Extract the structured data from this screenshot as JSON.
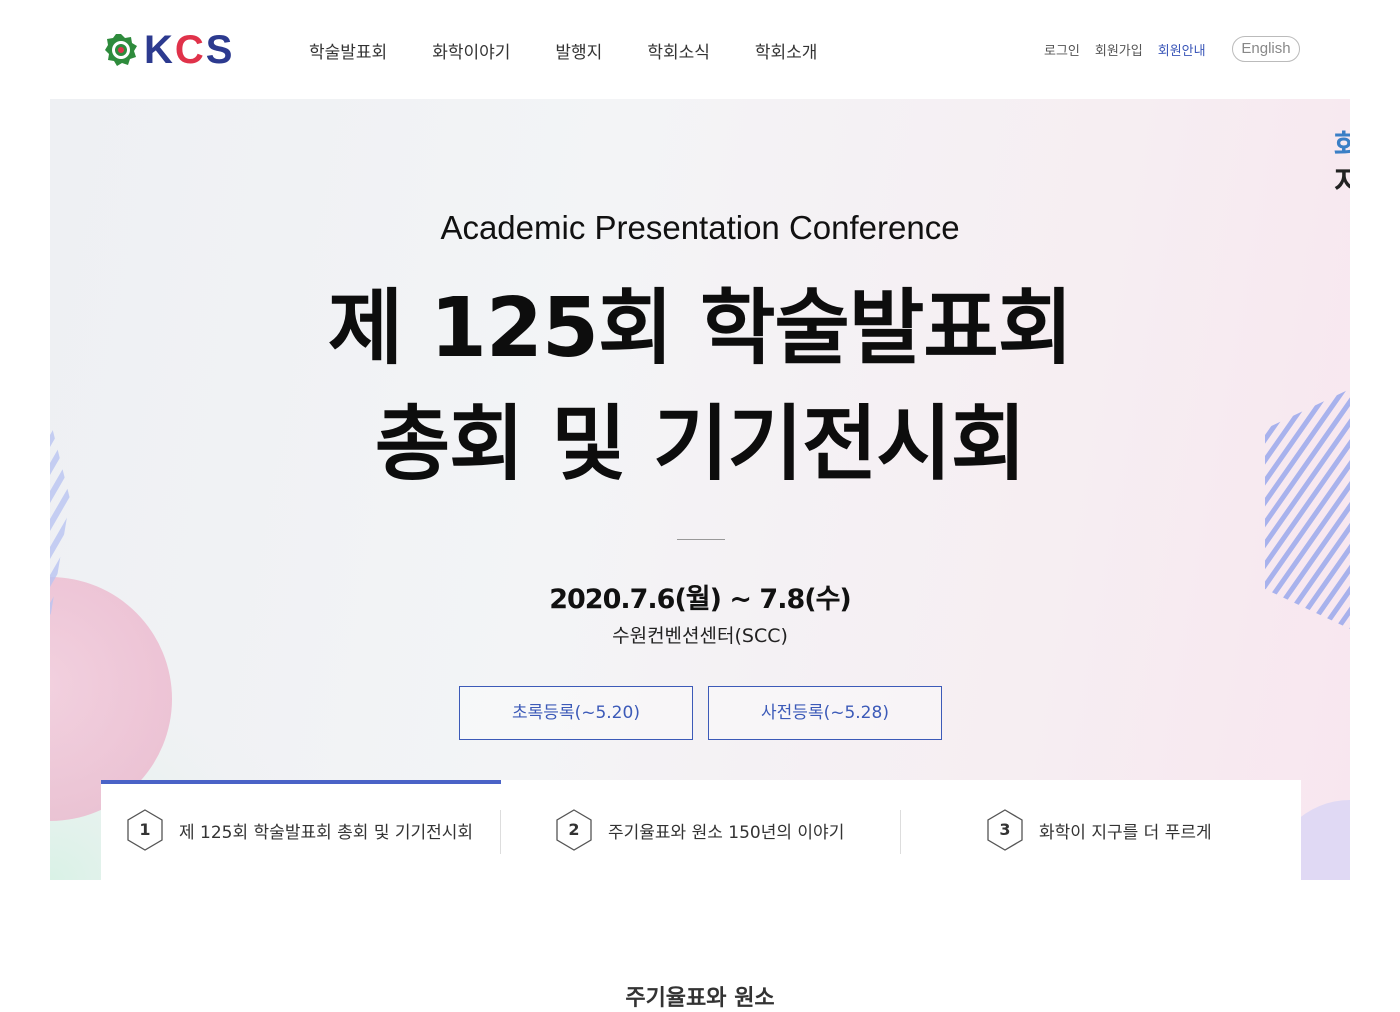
{
  "header": {
    "logo_text_k": "K",
    "logo_text_c": "C",
    "logo_text_s": "S",
    "nav": [
      "학술발표회",
      "화학이야기",
      "발행지",
      "학회소식",
      "학회소개"
    ],
    "util": [
      "로그인",
      "회원가입",
      "회원안내"
    ],
    "lang": "English"
  },
  "hero": {
    "subtitle": "Academic Presentation Conference",
    "title_line1": "제 125회 학술발표회",
    "title_line2": "총회 및 기기전시회",
    "date": "2020.7.6(월) ~ 7.8(수)",
    "venue": "수원컨벤션센터(SCC)",
    "btn_abstract": "초록등록(~5.20)",
    "btn_pre": "사전등록(~5.28)",
    "side_char1": "화",
    "side_char2": "지"
  },
  "tabs": [
    {
      "num": "1",
      "label": "제 125회 학술발표회 총회 및 기기전시회"
    },
    {
      "num": "2",
      "label": "주기율표와 원소 150년의 이야기"
    },
    {
      "num": "3",
      "label": "화학이 지구를 더 푸르게"
    }
  ],
  "next_section_title": "주기율표와 원소",
  "colors": {
    "accent": "#4a63c7",
    "brand_navy": "#2c3a8f",
    "brand_red": "#e0324a",
    "brand_green": "#2e8b3c"
  }
}
